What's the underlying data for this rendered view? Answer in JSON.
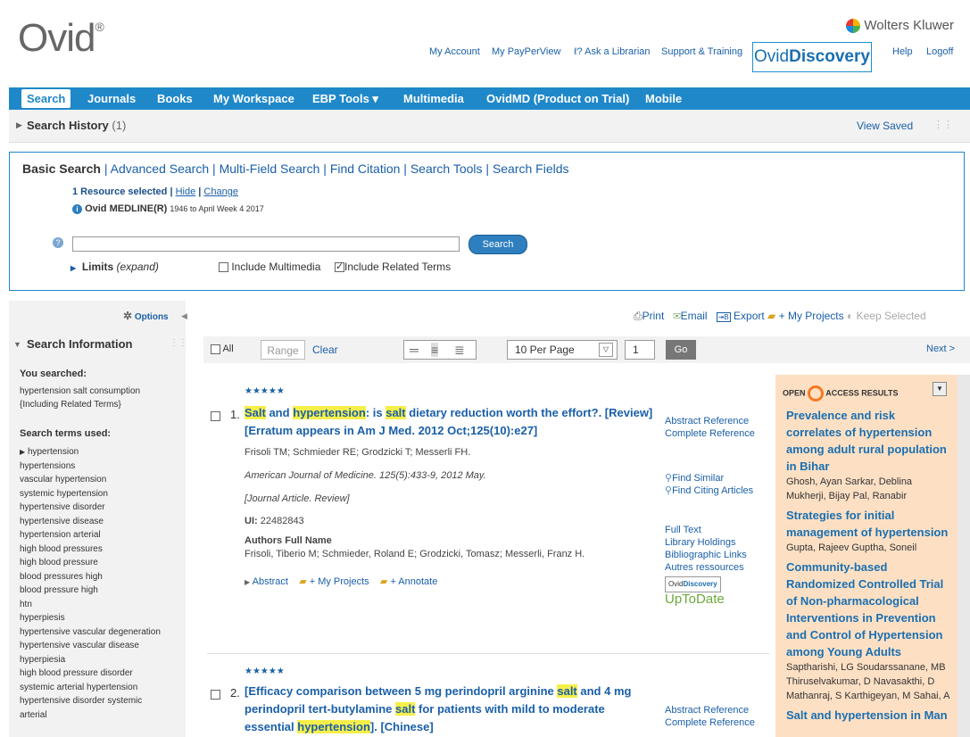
{
  "header": {
    "logo": "Ovid",
    "logo_mark": "®",
    "brand": "Wolters Kluwer",
    "links": [
      "My Account",
      "My PayPerView",
      "Ask a Librarian",
      "Support & Training"
    ],
    "discovery_prefix": "Ovid",
    "discovery_bold": "Discovery",
    "help": "Help",
    "logoff": "Logoff"
  },
  "nav": [
    "Search",
    "Journals",
    "Books",
    "My Workspace",
    "EBP Tools ▾",
    "Multimedia",
    "OvidMD (Product on Trial)",
    "Mobile"
  ],
  "history": {
    "label": "Search History",
    "count": "(1)",
    "view_saved": "View Saved"
  },
  "search": {
    "tab_active": "Basic Search",
    "tabs": [
      "Advanced Search",
      "Multi-Field Search",
      "Find Citation",
      "Search Tools",
      "Search Fields"
    ],
    "resource_text": "1 Resource selected",
    "hide": "Hide",
    "change": "Change",
    "database": "Ovid MEDLINE(R)",
    "database_range": "1946 to April Week 4 2017",
    "input_value": "",
    "button": "Search",
    "limits": "Limits",
    "limits_expand": "(expand)",
    "include_multimedia": "Include Multimedia",
    "include_related": "Include Related Terms"
  },
  "sidebar": {
    "options": "Options",
    "title": "Search Information",
    "you_searched_label": "You searched:",
    "you_searched": [
      "hypertension salt consumption",
      "{Including Related Terms}"
    ],
    "terms_label": "Search terms used:",
    "terms": [
      "hypertension",
      "hypertensions",
      "vascular hypertension",
      "systemic hypertension",
      "hypertensive disorder",
      "hypertensive disease",
      "hypertension arterial",
      "high blood pressures",
      "high blood pressure",
      "blood pressures high",
      "blood pressure high",
      "htn",
      "hyperpiesis",
      "hypertensive vascular degeneration",
      "hypertensive vascular disease",
      "hyperpiesia",
      "high blood pressure disorder",
      "systemic arterial hypertension",
      "hypertensive disorder systemic",
      "arterial"
    ]
  },
  "actions": {
    "print": "Print",
    "email": "Email",
    "export": "Export",
    "projects": "+ My Projects",
    "keep": "Keep Selected"
  },
  "toolbar": {
    "all": "All",
    "range": "Range",
    "clear": "Clear",
    "per_page": "10 Per Page",
    "page": "1",
    "go": "Go",
    "next": "Next >"
  },
  "results": {
    "r1": {
      "stars": "★★★★★",
      "num": "1.",
      "authors": "Frisoli TM; Schmieder RE; Grodzicki T; Messerli FH.",
      "source": "American Journal of Medicine. 125(5):433-9, 2012 May.",
      "type": "[Journal Article. Review]",
      "ui_label": "UI:",
      "ui": "22482843",
      "afn_label": "Authors Full Name",
      "afn": "Frisoli, Tiberio M; Schmieder, Roland E; Grodzicki, Tomasz; Messerli, Franz H.",
      "abstract": "Abstract",
      "projects": "+ My Projects",
      "annotate": "+ Annotate",
      "links": [
        "Abstract Reference",
        "Complete Reference"
      ],
      "links2": [
        "Find Similar",
        "Find Citing Articles"
      ],
      "links3": [
        "Full Text",
        "Library Holdings",
        "Bibliographic Links",
        "Autres ressources"
      ],
      "uptodate": "UpToDate"
    },
    "r2": {
      "stars": "★★★★★",
      "num": "2.",
      "links": [
        "Abstract Reference",
        "Complete Reference"
      ]
    }
  },
  "oar": {
    "heading_prefix": "OPEN",
    "heading_suffix": "ACCESS RESULTS",
    "items": [
      {
        "title": "Prevalence and risk correlates of hypertension among adult rural population in Bihar",
        "authors": "Ghosh, Ayan Sarkar, Deblina Mukherji, Bijay Pal, Ranabir"
      },
      {
        "title": "Strategies for initial management of hypertension",
        "authors": "Gupta, Rajeev Guptha, Soneil"
      },
      {
        "title": "Community-based Randomized Controlled Trial of Non-pharmacological Interventions in Prevention and Control of Hypertension among Young Adults",
        "authors": "Saptharishi, LG Soudarssanane, MB Thiruselvakumar, D Navasakthi, D Mathanraj, S Karthigeyan, M Sahai, A"
      },
      {
        "title": "Salt and hypertension in Man",
        "authors": ""
      }
    ]
  }
}
